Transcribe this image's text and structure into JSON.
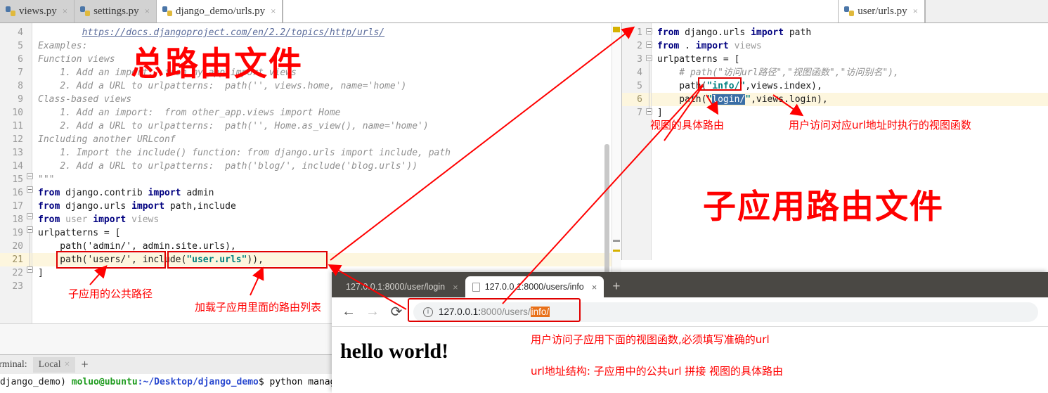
{
  "ide": {
    "tabs": [
      {
        "label": "views.py",
        "icon": "python-file-icon",
        "active": false
      },
      {
        "label": "settings.py",
        "icon": "python-file-icon",
        "active": false
      },
      {
        "label": "django_demo/urls.py",
        "icon": "python-file-icon",
        "active": true
      },
      {
        "label": "user/urls.py",
        "icon": "python-file-icon",
        "active": true
      }
    ],
    "close_glyph": "×"
  },
  "left_editor": {
    "file": "django_demo/urls.py",
    "first_line_no": 4,
    "current_line_no": 21,
    "lines": [
      {
        "no": 4,
        "text": "        https://docs.djangoproject.com/en/2.2/topics/http/urls/"
      },
      {
        "no": 5,
        "text": "Examples:"
      },
      {
        "no": 6,
        "text": "Function views"
      },
      {
        "no": 7,
        "text": "    1. Add an import:  from my_app import views"
      },
      {
        "no": 8,
        "text": "    2. Add a URL to urlpatterns:  path('', views.home, name='home')"
      },
      {
        "no": 9,
        "text": "Class-based views"
      },
      {
        "no": 10,
        "text": "    1. Add an import:  from other_app.views import Home"
      },
      {
        "no": 11,
        "text": "    2. Add a URL to urlpatterns:  path('', Home.as_view(), name='home')"
      },
      {
        "no": 12,
        "text": "Including another URLconf"
      },
      {
        "no": 13,
        "text": "    1. Import the include() function: from django.urls import include, path"
      },
      {
        "no": 14,
        "text": "    2. Add a URL to urlpatterns:  path('blog/', include('blog.urls'))"
      },
      {
        "no": 15,
        "text": "\"\"\""
      },
      {
        "no": 16,
        "text": "from django.contrib import admin"
      },
      {
        "no": 17,
        "text": "from django.urls import path,include"
      },
      {
        "no": 18,
        "text": "from user import views"
      },
      {
        "no": 19,
        "text": "urlpatterns = ["
      },
      {
        "no": 20,
        "text": "    path('admin/', admin.site.urls),"
      },
      {
        "no": 21,
        "text": "    path('users/', include(\"user.urls\")),"
      },
      {
        "no": 22,
        "text": "]"
      },
      {
        "no": 23,
        "text": ""
      }
    ]
  },
  "right_editor": {
    "file": "user/urls.py",
    "current_line_no": 6,
    "lines": [
      {
        "no": 1,
        "text": "from django.urls import path"
      },
      {
        "no": 2,
        "text": "from . import views"
      },
      {
        "no": 3,
        "text": "urlpatterns = ["
      },
      {
        "no": 4,
        "text": "    # path(\"访问url路径\",\"视图函数\",\"访问别名\"),"
      },
      {
        "no": 5,
        "text": "    path(\"info/\",views.index),"
      },
      {
        "no": 6,
        "text": "    path(\"login/\",views.login),"
      },
      {
        "no": 7,
        "text": "]"
      }
    ],
    "selected_text": "login/"
  },
  "terminal": {
    "label": "erminal:",
    "tab": "Local",
    "close_glyph": "×",
    "plus_glyph": "+",
    "prompt_env": "django_demo)",
    "prompt_user": "moluo@ubuntu",
    "prompt_path": ":~/Desktop/django_demo",
    "prompt_dollar": "$",
    "command": " python manage.py ru"
  },
  "browser": {
    "tabs": [
      {
        "label": "127.0.0.1:8000/user/login",
        "active": false
      },
      {
        "label": "127.0.0.1:8000/users/info",
        "active": true
      }
    ],
    "new_tab_glyph": "+",
    "close_glyph": "×",
    "back_glyph": "←",
    "forward_glyph": "→",
    "reload_glyph": "⟳",
    "info_glyph": "i",
    "url_parts": {
      "host": "127.0.0.1:",
      "port": "8000",
      "path": "/users/",
      "highlight": "info/"
    },
    "page_text": "hello world!"
  },
  "annotations": {
    "left_title": "总路由文件",
    "right_title": "子应用路由文件",
    "app_public_path": "子应用的公共路径",
    "load_sub_routes": "加载子应用里面的路由列表",
    "view_route": "视图的具体路由",
    "view_func": "用户访问对应url地址时执行的视图函数",
    "must_correct_url": "用户访问子应用下面的视图函数,必须填写准确的url",
    "url_structure": "url地址结构:  子应用中的公共url 拼接  视图的具体路由",
    "color": "#ff0000"
  }
}
